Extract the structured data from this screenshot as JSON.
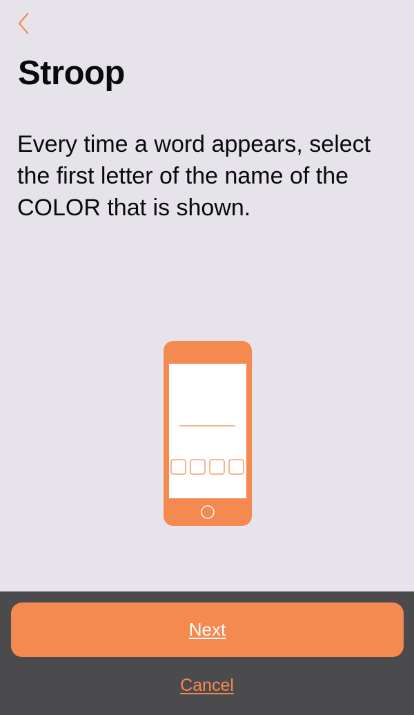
{
  "nav": {
    "back_icon": "chevron-left-icon"
  },
  "title": "Stroop",
  "instructions": "Every time a word appears, select the first letter of the name of the COLOR that is shown.",
  "illustration": {
    "icon": "phone-illustration-icon"
  },
  "footer": {
    "next_label": "Next",
    "cancel_label": "Cancel"
  },
  "colors": {
    "accent": "#f58a51",
    "background": "#e6e4ea",
    "footer_background": "#4b4a4d",
    "text": "#0a0a0a"
  }
}
